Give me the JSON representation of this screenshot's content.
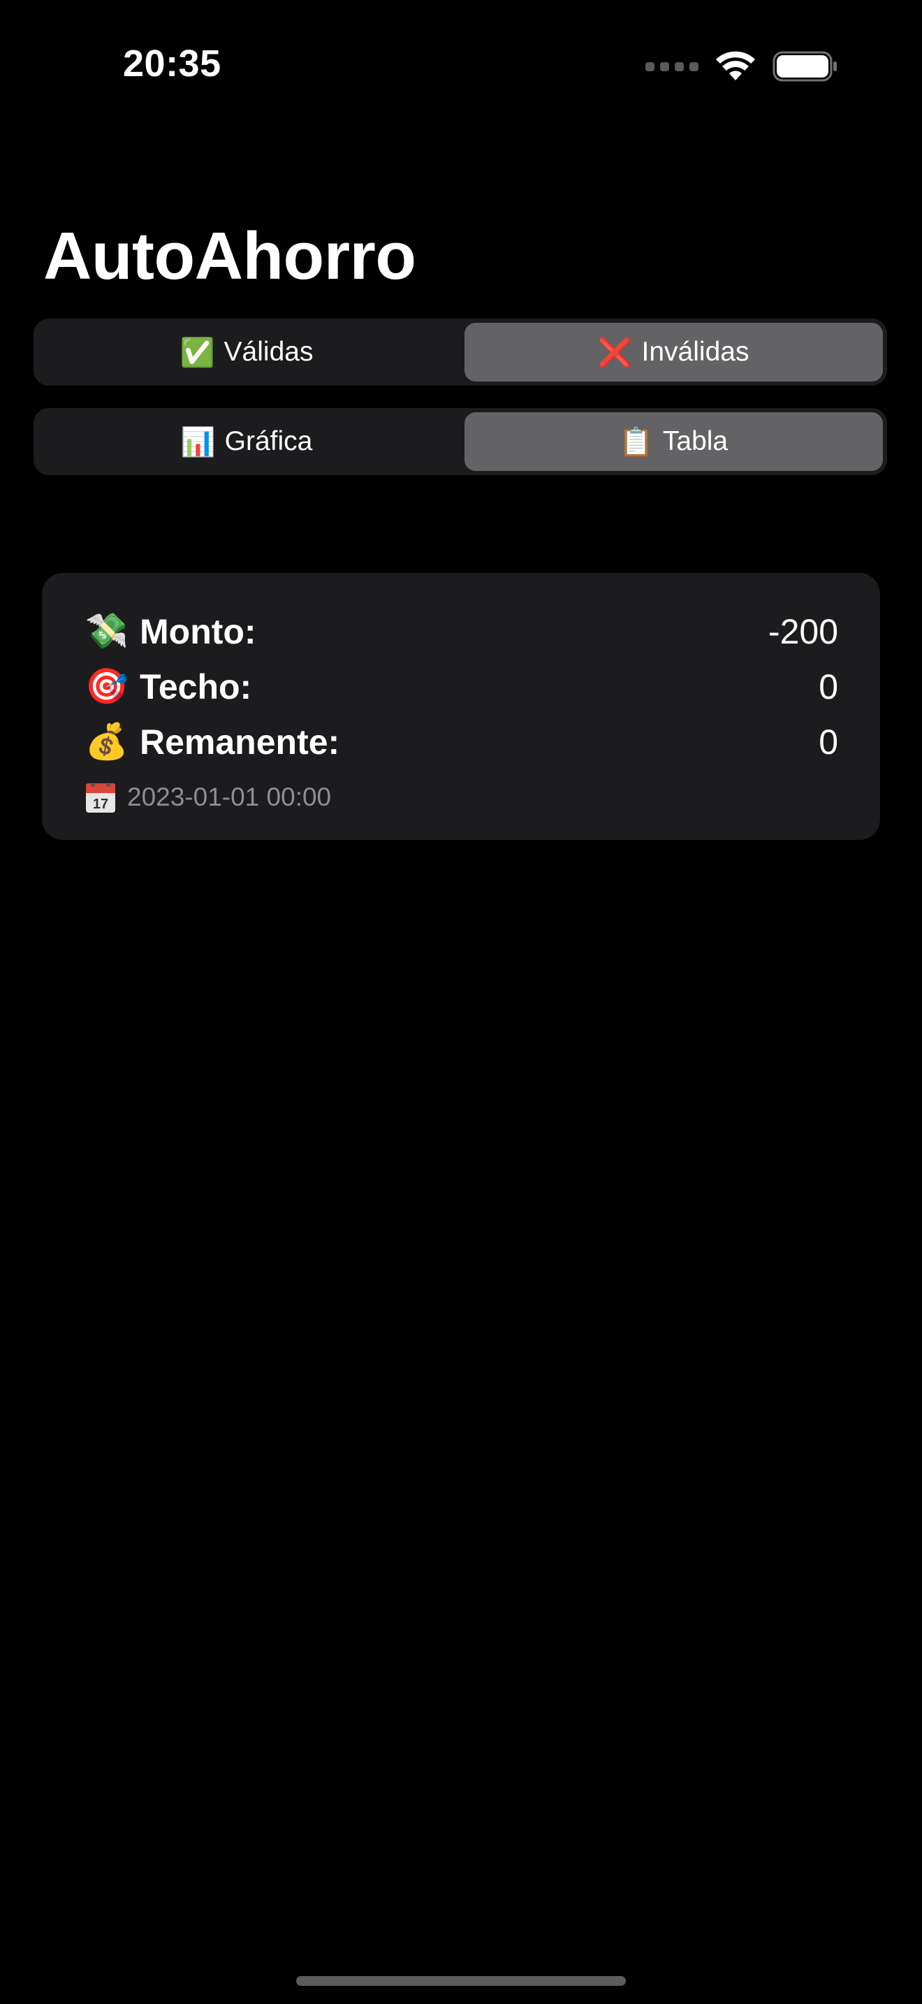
{
  "status_bar": {
    "time": "20:35"
  },
  "app": {
    "title": "AutoAhorro"
  },
  "filter_tabs": [
    {
      "emoji": "✅",
      "label": "Válidas",
      "selected": false
    },
    {
      "emoji": "❌",
      "label": "Inválidas",
      "selected": true
    }
  ],
  "view_tabs": [
    {
      "emoji": "📊",
      "label": "Gráfica",
      "selected": false
    },
    {
      "emoji": "📋",
      "label": "Tabla",
      "selected": true
    }
  ],
  "entry": {
    "monto": {
      "emoji": "💸",
      "label": "Monto:",
      "value": "-200"
    },
    "techo": {
      "emoji": "🎯",
      "label": "Techo:",
      "value": "0"
    },
    "remanente": {
      "emoji": "💰",
      "label": "Remanente:",
      "value": "0"
    },
    "date": {
      "emoji": "📅",
      "text": "2023-01-01 00:00"
    }
  },
  "colors": {
    "background": "#000000",
    "surface": "#1c1c1e",
    "selected_segment": "#636366",
    "secondary_text": "#8e8e93"
  }
}
